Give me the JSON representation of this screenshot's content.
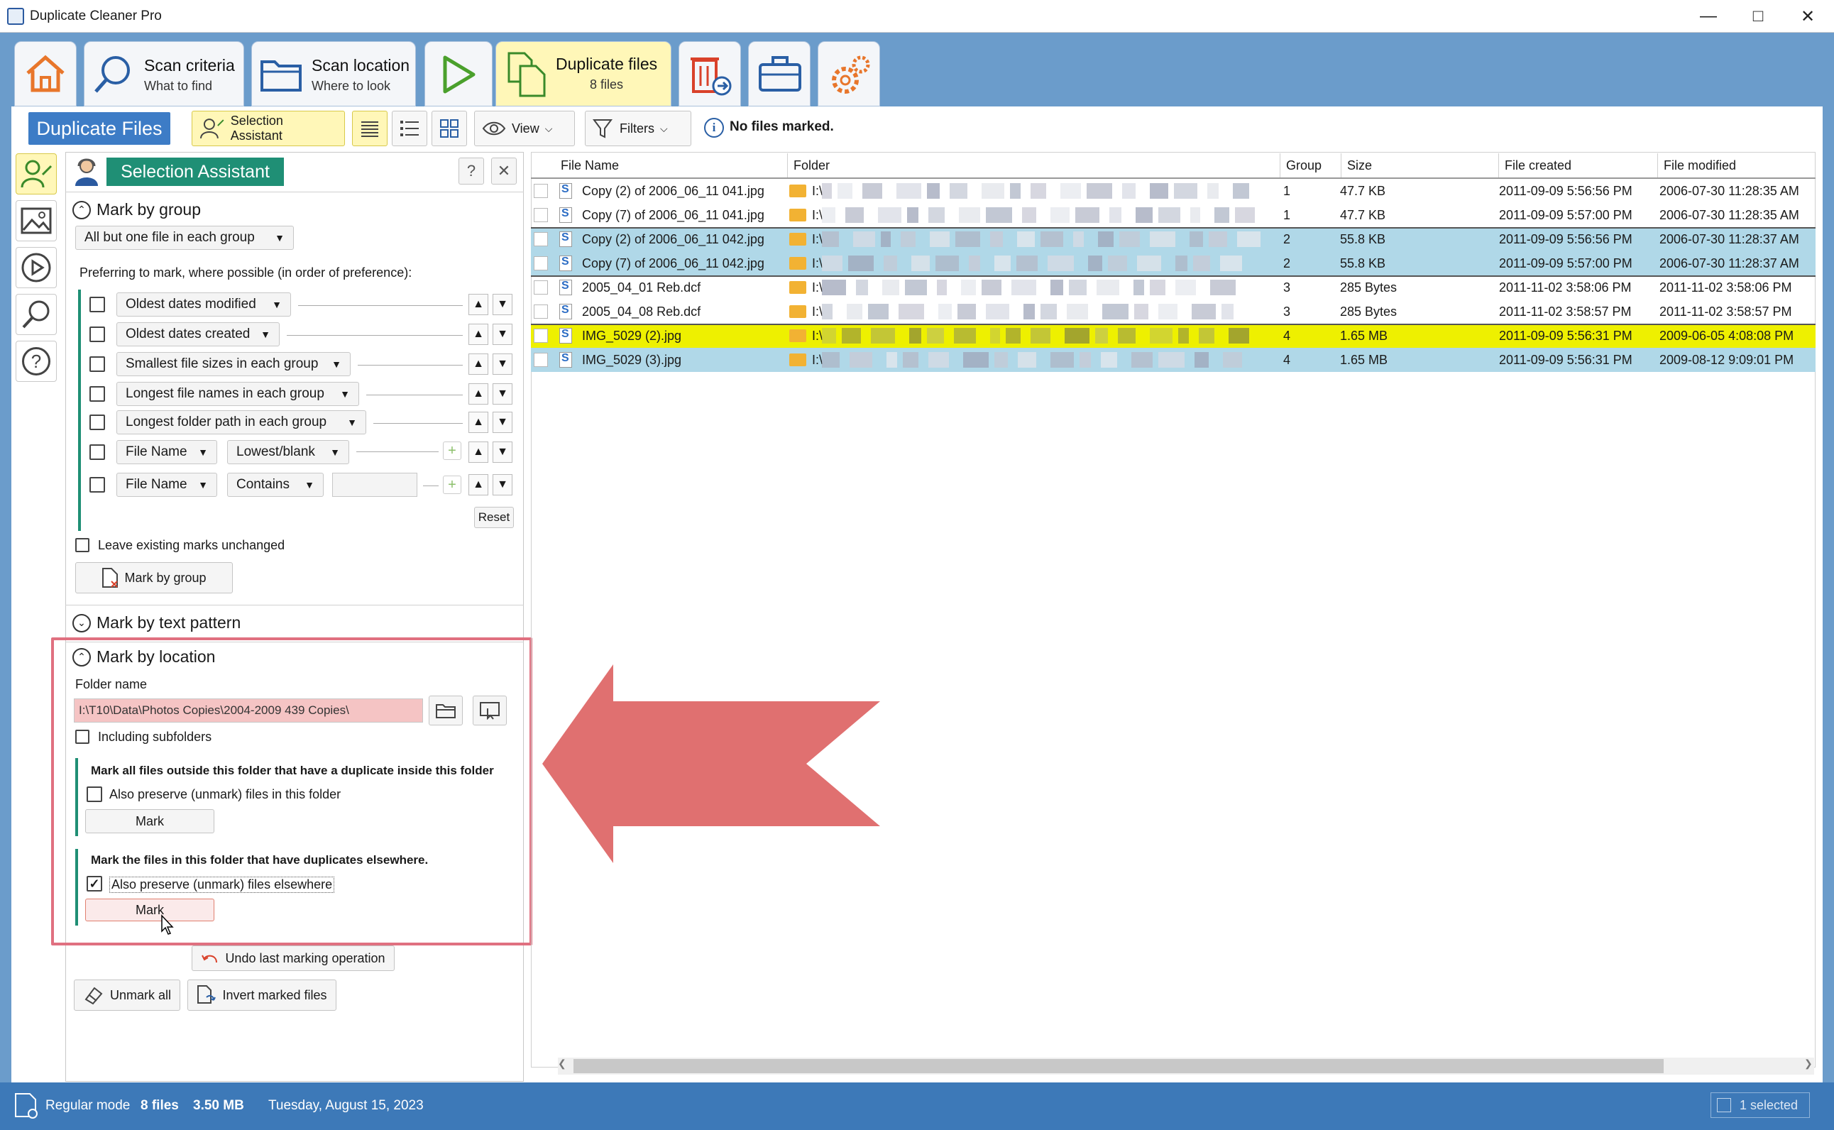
{
  "window": {
    "title": "Duplicate Cleaner Pro"
  },
  "tabs": {
    "scan_criteria": {
      "label": "Scan criteria",
      "sub": "What to find"
    },
    "scan_location": {
      "label": "Scan location",
      "sub": "Where to look"
    },
    "duplicate_files": {
      "label": "Duplicate files",
      "sub": "8 files"
    }
  },
  "toolbar": {
    "title": "Duplicate Files",
    "selection_assistant": "Selection Assistant",
    "view": "View",
    "filters": "Filters",
    "no_files_marked": "No files marked."
  },
  "panel": {
    "title": "Selection Assistant",
    "help": "?",
    "mark_by_group": {
      "heading": "Mark by group",
      "mode": "All but one file in each group",
      "pref_label": "Preferring to mark, where possible (in order of preference):",
      "rules": [
        {
          "label": "Oldest dates modified"
        },
        {
          "label": "Oldest dates created"
        },
        {
          "label": "Smallest file sizes in each group"
        },
        {
          "label": "Longest file names in each group"
        },
        {
          "label": "Longest folder path in each group"
        }
      ],
      "rule6": {
        "field": "File Name",
        "cond": "Lowest/blank"
      },
      "rule7": {
        "field": "File Name",
        "cond": "Contains",
        "value": ""
      },
      "reset": "Reset",
      "leave_existing": "Leave existing marks unchanged",
      "mark_button": "Mark by group"
    },
    "mark_by_text": {
      "heading": "Mark by text pattern"
    },
    "mark_by_location": {
      "heading": "Mark by location",
      "folder_label": "Folder name",
      "folder_value": "I:\\T10\\Data\\Photos Copies\\2004-2009 439 Copies\\",
      "including_subfolders": "Including subfolders",
      "outside_heading": "Mark all files outside this folder that have a duplicate inside this folder",
      "also_preserve_inside": "Also preserve (unmark) files in this folder",
      "mark1": "Mark",
      "inside_heading": "Mark the files in this folder that have duplicates elsewhere.",
      "also_preserve_elsewhere": "Also preserve (unmark) files elsewhere",
      "also_preserve_elsewhere_checked": true,
      "mark2": "Mark"
    },
    "undo": "Undo last marking operation",
    "unmark_all": "Unmark all",
    "invert": "Invert marked files"
  },
  "grid": {
    "columns": [
      "File Name",
      "Folder",
      "Group",
      "Size",
      "File created",
      "File modified"
    ],
    "rows": [
      {
        "name": "Copy (2) of 2006_06_11 041.jpg",
        "folder": "I:\\",
        "group": "1",
        "size": "47.7 KB",
        "created": "2011-09-09 5:56:56 PM",
        "modified": "2006-07-30 11:28:35 AM",
        "style": "normal"
      },
      {
        "name": "Copy (7) of 2006_06_11 041.jpg",
        "folder": "I:\\",
        "group": "1",
        "size": "47.7 KB",
        "created": "2011-09-09 5:57:00 PM",
        "modified": "2006-07-30 11:28:35 AM",
        "style": "normal"
      },
      {
        "name": "Copy (2) of 2006_06_11 042.jpg",
        "folder": "I:\\",
        "group": "2",
        "size": "55.8 KB",
        "created": "2011-09-09 5:56:56 PM",
        "modified": "2006-07-30 11:28:37 AM",
        "style": "sel"
      },
      {
        "name": "Copy (7) of 2006_06_11 042.jpg",
        "folder": "I:\\",
        "group": "2",
        "size": "55.8 KB",
        "created": "2011-09-09 5:57:00 PM",
        "modified": "2006-07-30 11:28:37 AM",
        "style": "sel"
      },
      {
        "name": "2005_04_01 Reb.dcf",
        "folder": "I:\\",
        "group": "3",
        "size": "285 Bytes",
        "created": "2011-11-02 3:58:06 PM",
        "modified": "2011-11-02 3:58:06 PM",
        "style": "normal"
      },
      {
        "name": "2005_04_08 Reb.dcf",
        "folder": "I:\\",
        "group": "3",
        "size": "285 Bytes",
        "created": "2011-11-02 3:58:57 PM",
        "modified": "2011-11-02 3:58:57 PM",
        "style": "normal"
      },
      {
        "name": "IMG_5029 (2).jpg",
        "folder": "I:\\",
        "group": "4",
        "size": "1.65 MB",
        "created": "2011-09-09 5:56:31 PM",
        "modified": "2009-06-05 4:08:08 PM",
        "style": "yel"
      },
      {
        "name": "IMG_5029 (3).jpg",
        "folder": "I:\\",
        "group": "4",
        "size": "1.65 MB",
        "created": "2011-09-09 5:56:31 PM",
        "modified": "2009-08-12 9:09:01 PM",
        "style": "sel"
      }
    ]
  },
  "status": {
    "mode": "Regular mode",
    "files": "8 files",
    "size": "3.50 MB",
    "date": "Tuesday, August 15, 2023",
    "selected": "1 selected"
  },
  "colors": {
    "accent_blue": "#3d7cc6",
    "accent_green": "#1f8f75",
    "highlight_red": "#e07070",
    "yellow": "#eef000",
    "selected_row": "#b0d8e8"
  }
}
